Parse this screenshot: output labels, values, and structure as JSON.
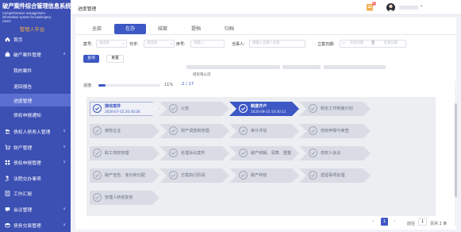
{
  "app": {
    "title": "破产案件综合管理信息系统",
    "subtitle": "Comprehensive management information system for bankruptcy cases",
    "role": "管理人平台"
  },
  "sidebar": {
    "items": [
      {
        "label": "首页",
        "icon": "home-icon"
      },
      {
        "label": "破产案件管理",
        "icon": "briefcase-icon",
        "expanded": true
      },
      {
        "label": "我的案件",
        "sub": true
      },
      {
        "label": "退回报告",
        "sub": true
      },
      {
        "label": "进度管理",
        "sub": true,
        "active": true
      },
      {
        "label": "债权申报通知",
        "sub": true
      },
      {
        "label": "债权人债务人管理",
        "icon": "users-icon"
      },
      {
        "label": "财产管理",
        "icon": "cart-icon"
      },
      {
        "label": "债权申报管理",
        "icon": "grid-icon"
      },
      {
        "label": "法院交办事项",
        "icon": "gavel-icon"
      },
      {
        "label": "工作汇报",
        "icon": "report-icon"
      },
      {
        "label": "会议管理",
        "icon": "meeting-icon"
      },
      {
        "label": "债务交易管理",
        "icon": "coins-icon"
      }
    ]
  },
  "topbar": {
    "title": "进度管理",
    "notification_count": "4",
    "user_name": "",
    "caret": "▾"
  },
  "tabs": [
    {
      "label": "全部"
    },
    {
      "label": "在办",
      "active": true
    },
    {
      "label": "结案"
    },
    {
      "label": "提档"
    },
    {
      "label": "归档"
    }
  ],
  "filters": {
    "case_no_label": "案号:",
    "case_no_placeholder": "请选择",
    "word_label": "代字:",
    "word_placeholder": "请选择",
    "seq_label": "序号:",
    "seq_placeholder": "请输入",
    "party_label": "当事人:",
    "party_placeholder": "请输入当事人名称",
    "date_label": "立案日期:",
    "start_placeholder": "开始日期",
    "end_placeholder": "结束日期",
    "date_separator": "至",
    "search_button": "查询",
    "reset_button": "重置"
  },
  "case_card": {
    "prefix": "",
    "line2": "",
    "company_suffix": "结有限公司",
    "progress_label": "进度:",
    "progress_value": 0.11,
    "progress_percent": "11%",
    "progress_count": "2 / 17"
  },
  "flow_steps": [
    {
      "label": "接收案件",
      "state": "done",
      "date": "2020-07-15 20:30:26"
    },
    {
      "label": "公告",
      "state": "pending"
    },
    {
      "label": "制度开户",
      "state": "current",
      "date": "2020-09-15 10:30:11"
    },
    {
      "label": "制定工作制度计划",
      "state": "pending"
    },
    {
      "label": "接管企业",
      "state": "pending"
    },
    {
      "label": "财产调查和管理",
      "state": "pending"
    },
    {
      "label": "审计评估",
      "state": "pending"
    },
    {
      "label": "债权申报与审查",
      "state": "pending"
    },
    {
      "label": "职工债权管理",
      "state": "pending"
    },
    {
      "label": "处理诉讼案件",
      "state": "pending"
    },
    {
      "label": "破产和解、清算、重整",
      "state": "pending"
    },
    {
      "label": "债权人会议",
      "state": "pending"
    },
    {
      "label": "破产宣告、变价和分配",
      "state": "pending"
    },
    {
      "label": "方案执行阶段",
      "state": "pending"
    },
    {
      "label": "破产终结",
      "state": "pending"
    },
    {
      "label": "遗留事项处理",
      "state": "pending"
    },
    {
      "label": "管理人终结职务",
      "state": "pending"
    }
  ],
  "pagination": {
    "prev": "‹",
    "current": "1",
    "next": "›",
    "goto_label": "前往",
    "goto_value": "1",
    "total": "页共 2 条"
  },
  "colors": {
    "sidebar_bg": "#3c4fb3",
    "primary": "#3d58c4",
    "role_text": "#f0ad4e",
    "badge": "#f56c6c"
  }
}
